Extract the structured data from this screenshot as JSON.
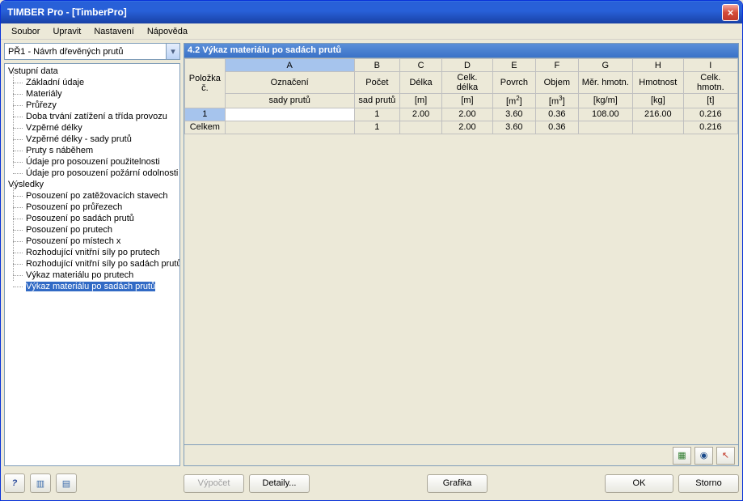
{
  "title": "TIMBER Pro - [TimberPro]",
  "menu": [
    "Soubor",
    "Upravit",
    "Nastavení",
    "Nápověda"
  ],
  "combo": "PŘ1 - Návrh dřevěných prutů",
  "tree": {
    "group1": {
      "label": "Vstupní data",
      "items": [
        "Základní údaje",
        "Materiály",
        "Průřezy",
        "Doba trvání zatížení a třída provozu",
        "Vzpěrné délky",
        "Vzpěrné délky - sady prutů",
        "Pruty s náběhem",
        "Údaje pro posouzení použitelnosti",
        "Údaje pro posouzení požární odolnosti"
      ]
    },
    "group2": {
      "label": "Výsledky",
      "items": [
        "Posouzení po zatěžovacích stavech",
        "Posouzení po průřezech",
        "Posouzení po sadách prutů",
        "Posouzení po prutech",
        "Posouzení po místech x",
        "Rozhodující vnitřní síly po prutech",
        "Rozhodující vnitřní síly po sadách prutů",
        "Výkaz materiálu po prutech",
        "Výkaz materiálu po sadách prutů"
      ]
    },
    "selected": "Výkaz materiálu po sadách prutů"
  },
  "grid": {
    "title": "4.2 Výkaz materiálu po sadách prutů",
    "corner1": "Položka",
    "corner2": "č.",
    "letters": [
      "A",
      "B",
      "C",
      "D",
      "E",
      "F",
      "G",
      "H",
      "I"
    ],
    "headers": [
      [
        "Označení",
        "Počet",
        "Délka",
        "Celk. délka",
        "Povrch",
        "Objem",
        "Měr. hmotn.",
        "Hmotnost",
        "Celk. hmotn."
      ],
      [
        "sady prutů",
        "sad prutů",
        "[m]",
        "[m]",
        "[m2]",
        "[m3]",
        "[kg/m]",
        "[kg]",
        "[t]"
      ]
    ],
    "row1": {
      "n": "1",
      "cells": [
        "",
        "1",
        "2.00",
        "2.00",
        "3.60",
        "0.36",
        "108.00",
        "216.00",
        "0.216"
      ]
    },
    "sum": {
      "n": "Celkem",
      "cells": [
        "",
        "1",
        "",
        "2.00",
        "3.60",
        "0.36",
        "",
        "",
        "0.216"
      ]
    }
  },
  "buttons": {
    "vypocet": "Výpočet",
    "detaily": "Detaily...",
    "grafika": "Grafika",
    "ok": "OK",
    "storno": "Storno"
  },
  "tool_icons": {
    "excel": "▦",
    "eye": "◉",
    "pick": "↖"
  },
  "bottom_icons": {
    "help": "?",
    "b1": "▥",
    "b2": "▤"
  }
}
